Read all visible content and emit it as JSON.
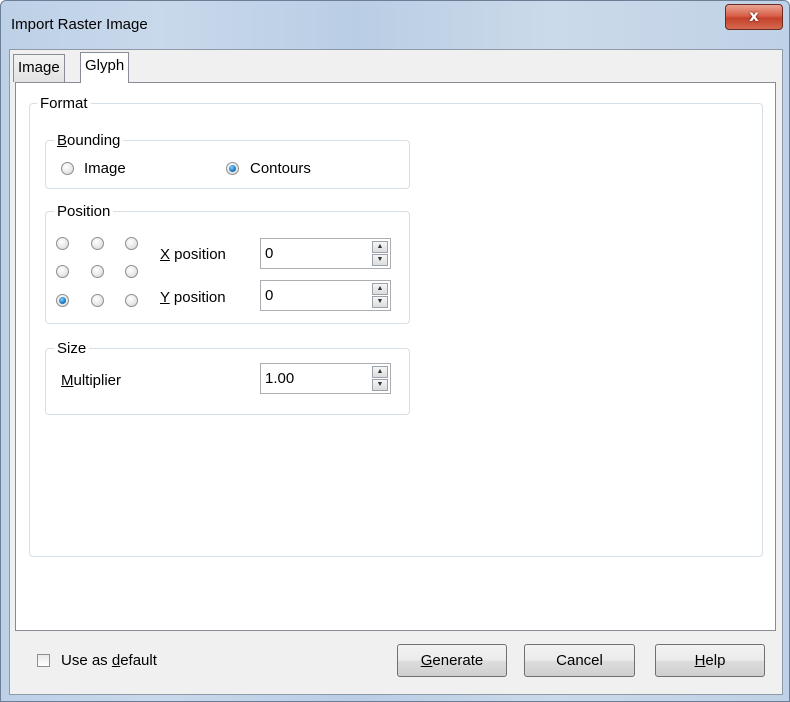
{
  "window": {
    "title": "Import Raster Image",
    "close_glyph": "x"
  },
  "tabs": [
    {
      "label": "Image",
      "active": false
    },
    {
      "label": "Glyph",
      "active": true
    }
  ],
  "format": {
    "label": "Format",
    "bounding": {
      "label_first": "B",
      "label_rest": "ounding",
      "options": [
        {
          "label": "Image",
          "selected": false
        },
        {
          "label": "Contours",
          "selected": true
        }
      ]
    },
    "position": {
      "label": "Position",
      "grid_selected": "bottom-left",
      "x": {
        "label_first": "X",
        "label_rest": " position",
        "value": "0"
      },
      "y": {
        "label_first": "Y",
        "label_rest": " position",
        "value": "0"
      }
    },
    "size": {
      "label": "Size",
      "multiplier": {
        "label_first": "M",
        "label_rest": "ultiplier",
        "value": "1.00"
      }
    }
  },
  "footer": {
    "use_default": {
      "label_pre": "Use as ",
      "label_u": "d",
      "label_post": "efault",
      "checked": false
    },
    "buttons": {
      "generate": {
        "u": "G",
        "rest": "enerate"
      },
      "cancel": "Cancel",
      "help": {
        "u": "H",
        "rest": "elp"
      }
    }
  },
  "colors": {
    "radio_selected": "#1d7fc4",
    "close_button": "#c4422b",
    "titlebar": "#c3d4e8"
  },
  "icons": {
    "close": "close-icon",
    "spin_up": "spin-up-icon",
    "spin_down": "spin-down-icon"
  }
}
